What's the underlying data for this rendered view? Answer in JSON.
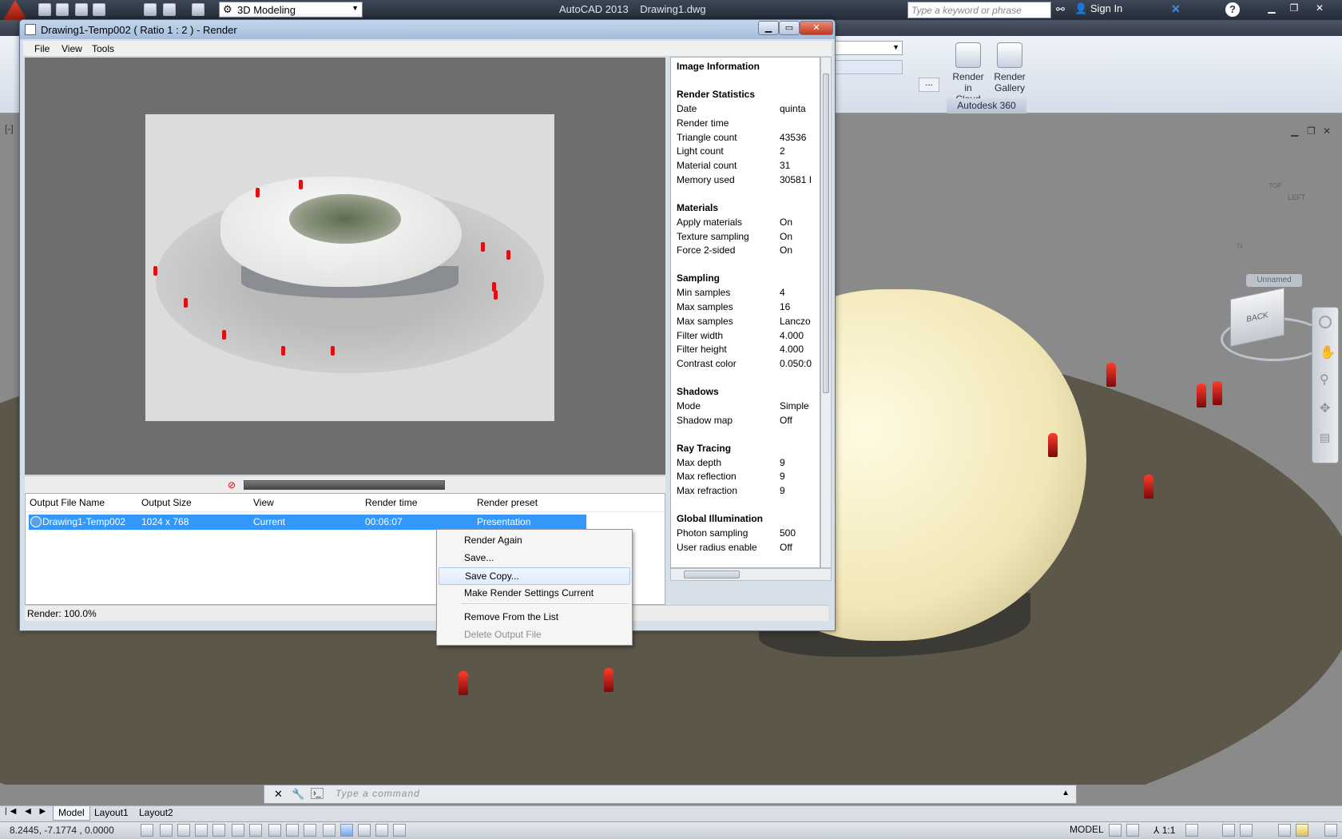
{
  "app": {
    "title": "AutoCAD 2013",
    "file": "Drawing1.dwg",
    "workspace": "3D Modeling",
    "search_placeholder": "Type a keyword or phrase",
    "sign_in": "Sign In"
  },
  "ribbon": {
    "render_cloud": [
      "Render in",
      "Cloud"
    ],
    "render_gallery": [
      "Render",
      "Gallery"
    ],
    "panel_label": "Autodesk 360"
  },
  "viewport": {
    "viewcube_face": "BACK",
    "viewcube_side": "LEFT",
    "viewcube_top": "TOP",
    "compass_n": "N",
    "named_view": "Unnamed"
  },
  "render_window": {
    "title": "Drawing1-Temp002  ( Ratio 1 : 2 ) - Render",
    "menu": [
      "File",
      "View",
      "Tools"
    ],
    "list_headers": [
      "Output File Name",
      "Output Size",
      "View",
      "Render time",
      "Render preset"
    ],
    "row": {
      "name": "Drawing1-Temp002",
      "size": "1024 x 768",
      "view": "Current",
      "time": "00:06:07",
      "preset": "Presentation"
    },
    "status": "Render: 100.0%",
    "progress": 1.0
  },
  "info": {
    "title": "Image Information",
    "sections": [
      {
        "name": "Render Statistics",
        "rows": [
          [
            "Date",
            "quinta"
          ],
          [
            "Render time",
            ""
          ],
          [
            "Triangle count",
            "43536"
          ],
          [
            "Light count",
            "2"
          ],
          [
            "Material count",
            "31"
          ],
          [
            "Memory used",
            "30581 I"
          ]
        ]
      },
      {
        "name": "Materials",
        "rows": [
          [
            "Apply materials",
            "On"
          ],
          [
            "Texture sampling",
            "On"
          ],
          [
            "Force 2-sided",
            "On"
          ]
        ]
      },
      {
        "name": "Sampling",
        "rows": [
          [
            "Min samples",
            "4"
          ],
          [
            "Max samples",
            "16"
          ],
          [
            "Max samples",
            "Lanczo"
          ],
          [
            "Filter width",
            "4.000"
          ],
          [
            "Filter height",
            "4.000"
          ],
          [
            "Contrast color",
            "0.050:0"
          ]
        ]
      },
      {
        "name": "Shadows",
        "rows": [
          [
            "Mode",
            "Simple"
          ],
          [
            "Shadow map",
            "Off"
          ]
        ]
      },
      {
        "name": "Ray Tracing",
        "rows": [
          [
            "Max depth",
            "9"
          ],
          [
            "Max reflection",
            "9"
          ],
          [
            "Max refraction",
            "9"
          ]
        ]
      },
      {
        "name": "Global Illumination",
        "rows": [
          [
            "Photon sampling",
            "500"
          ],
          [
            "User radius enable",
            "Off"
          ]
        ]
      }
    ]
  },
  "context_menu": {
    "items": [
      "Render Again",
      "Save...",
      "Save Copy...",
      "Make Render Settings Current",
      "Remove From the List",
      "Delete Output File"
    ]
  },
  "command": {
    "placeholder": "Type  a  command"
  },
  "tabs": [
    "Model",
    "Layout1",
    "Layout2"
  ],
  "status": {
    "coords": "8.2445, -7.1774 , 0.0000",
    "model": "MODEL",
    "scale": "1:1"
  }
}
